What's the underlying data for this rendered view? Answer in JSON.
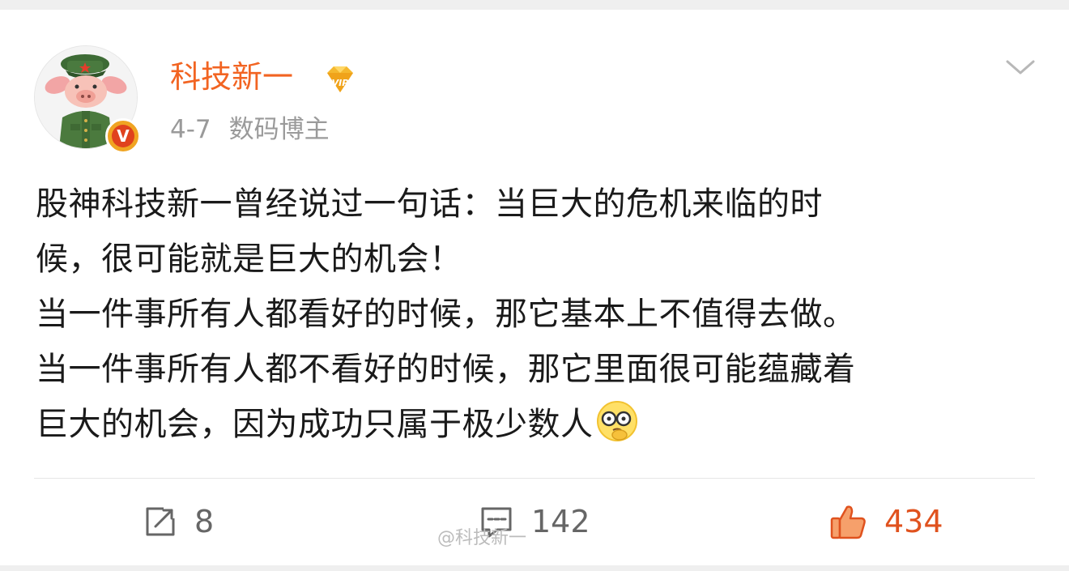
{
  "post": {
    "author": {
      "name": "科技新一",
      "badge_letter": "V"
    },
    "meta": {
      "date": "4-7",
      "role": "数码博主"
    },
    "text_lines": [
      "股神科技新一曾经说过一句话：当巨大的危机来临的时",
      "候，很可能就是巨大的机会！",
      "当一件事所有人都看好的时候，那它基本上不值得去做。",
      "当一件事所有人都不看好的时候，那它里面很可能蕴藏着",
      "巨大的机会，因为成功只属于极少数人"
    ],
    "emoji_icon": "thinking-face-emoji"
  },
  "actions": {
    "repost_count": "8",
    "comment_count": "142",
    "like_count": "434"
  },
  "watermark": "@科技新一",
  "colors": {
    "username": "#f26422",
    "like": "#e0521e",
    "meta": "#9a9a9a",
    "text": "#1a1a1a"
  },
  "icons": [
    "vip-diamond-icon",
    "chevron-down-icon",
    "repost-icon",
    "comment-icon",
    "thumbs-up-icon"
  ]
}
